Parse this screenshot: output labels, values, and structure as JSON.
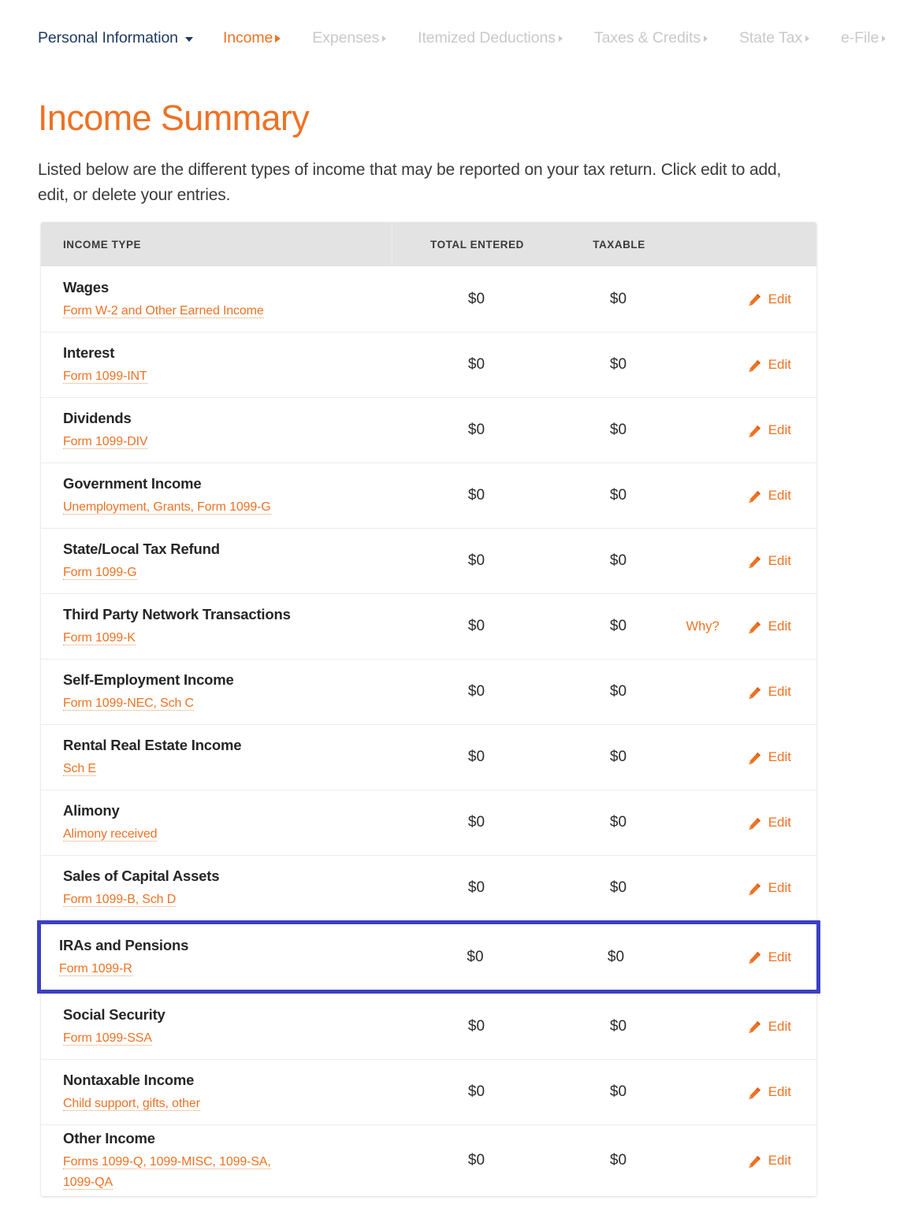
{
  "nav": {
    "items": [
      {
        "label": "Personal Information",
        "state": "primary",
        "icon": "chevron-down-icon"
      },
      {
        "label": "Income",
        "state": "active",
        "icon": "chevron-right-icon"
      },
      {
        "label": "Expenses",
        "state": "muted",
        "icon": "chevron-right-icon"
      },
      {
        "label": "Itemized Deductions",
        "state": "muted",
        "icon": "chevron-right-icon"
      },
      {
        "label": "Taxes & Credits",
        "state": "muted",
        "icon": "chevron-right-icon"
      },
      {
        "label": "State Tax",
        "state": "muted",
        "icon": "chevron-right-icon"
      },
      {
        "label": "e-File",
        "state": "muted",
        "icon": "chevron-right-icon"
      }
    ]
  },
  "page": {
    "title": "Income Summary",
    "description": "Listed below are the different types of income that may be reported on your tax return. Click edit to add, edit, or delete your entries."
  },
  "table": {
    "headers": {
      "income_type": "INCOME TYPE",
      "total_entered": "TOTAL ENTERED",
      "taxable": "TAXABLE"
    },
    "edit_label": "Edit",
    "why_label": "Why?",
    "rows": [
      {
        "title": "Wages",
        "subtitle": "Form W-2 and Other Earned Income",
        "total": "$0",
        "taxable": "$0",
        "why": false,
        "highlighted": false
      },
      {
        "title": "Interest",
        "subtitle": "Form 1099-INT",
        "total": "$0",
        "taxable": "$0",
        "why": false,
        "highlighted": false
      },
      {
        "title": "Dividends",
        "subtitle": "Form 1099-DIV",
        "total": "$0",
        "taxable": "$0",
        "why": false,
        "highlighted": false
      },
      {
        "title": "Government Income",
        "subtitle": "Unemployment, Grants, Form 1099-G",
        "total": "$0",
        "taxable": "$0",
        "why": false,
        "highlighted": false
      },
      {
        "title": "State/Local Tax Refund",
        "subtitle": "Form 1099-G",
        "total": "$0",
        "taxable": "$0",
        "why": false,
        "highlighted": false
      },
      {
        "title": "Third Party Network Transactions",
        "subtitle": "Form 1099-K",
        "total": "$0",
        "taxable": "$0",
        "why": true,
        "highlighted": false
      },
      {
        "title": "Self-Employment Income",
        "subtitle": "Form 1099-NEC, Sch C",
        "total": "$0",
        "taxable": "$0",
        "why": false,
        "highlighted": false
      },
      {
        "title": "Rental Real Estate Income",
        "subtitle": "Sch E",
        "total": "$0",
        "taxable": "$0",
        "why": false,
        "highlighted": false
      },
      {
        "title": "Alimony",
        "subtitle": "Alimony received",
        "total": "$0",
        "taxable": "$0",
        "why": false,
        "highlighted": false
      },
      {
        "title": "Sales of Capital Assets",
        "subtitle": "Form 1099-B, Sch D",
        "total": "$0",
        "taxable": "$0",
        "why": false,
        "highlighted": false
      },
      {
        "title": "IRAs and Pensions",
        "subtitle": "Form 1099-R",
        "total": "$0",
        "taxable": "$0",
        "why": false,
        "highlighted": true
      },
      {
        "title": "Social Security",
        "subtitle": "Form 1099-SSA",
        "total": "$0",
        "taxable": "$0",
        "why": false,
        "highlighted": false
      },
      {
        "title": "Nontaxable Income",
        "subtitle": "Child support, gifts, other",
        "total": "$0",
        "taxable": "$0",
        "why": false,
        "highlighted": false
      },
      {
        "title": "Other Income",
        "subtitle": "Forms 1099-Q, 1099-MISC, 1099-SA, 1099-QA",
        "total": "$0",
        "taxable": "$0",
        "why": false,
        "highlighted": false
      }
    ]
  },
  "colors": {
    "accent_orange": "#ED7224",
    "nav_primary": "#1F3A60",
    "nav_muted": "#C9C9C9",
    "highlight_blue": "#3B3FC4",
    "header_bg": "#E3E3E3"
  }
}
